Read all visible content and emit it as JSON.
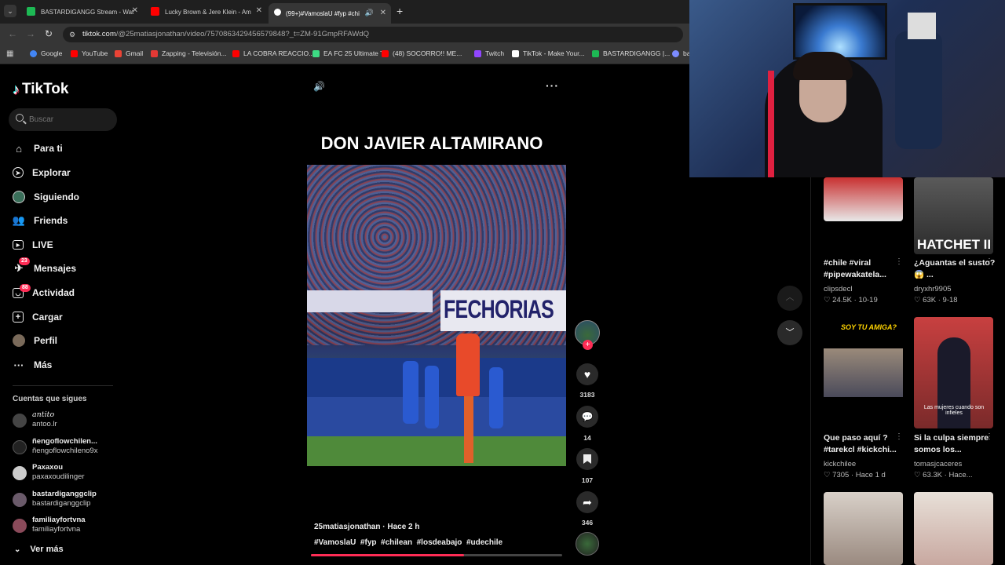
{
  "browser": {
    "tabs": [
      {
        "title": "BASTARDIGANGG Stream - Wat",
        "color": "#1db954"
      },
      {
        "title": "Lucky Brown & Jere Klein - Am",
        "color": "#ff0000"
      },
      {
        "title": "(99+)#VamoslaU #fyp #chi",
        "color": "#ffffff"
      }
    ],
    "url_host": "tiktok.com",
    "url_path": "/@25matiasjonathan/video/7570863429456579848?_t=ZM-91GmpRFAWdQ",
    "bookmarks": [
      {
        "label": "Google",
        "color": "#4285f4"
      },
      {
        "label": "YouTube",
        "color": "#ff0000"
      },
      {
        "label": "Gmail",
        "color": "#ea4335"
      },
      {
        "label": "Zapping - Televisión...",
        "color": "#e53935"
      },
      {
        "label": "LA COBRA REACCIO...",
        "color": "#ff0000"
      },
      {
        "label": "EA FC 25 Ultimate T...",
        "color": "#3ddc84"
      },
      {
        "label": "(48) SOCORRO!! ME...",
        "color": "#ff0000"
      },
      {
        "label": "Twitch",
        "color": "#9146ff"
      },
      {
        "label": "TikTok - Make Your...",
        "color": "#ffffff"
      },
      {
        "label": "BASTARDIGANGG |...",
        "color": "#1db954"
      },
      {
        "label": "ba",
        "color": "#7c8cff"
      }
    ]
  },
  "brand": {
    "name": "TikTok",
    "accent": "#fe2c55"
  },
  "search": {
    "placeholder": "Buscar"
  },
  "nav": [
    {
      "label": "Para ti",
      "icon": "home-icon",
      "badge": ""
    },
    {
      "label": "Explorar",
      "icon": "compass-icon",
      "badge": ""
    },
    {
      "label": "Siguiendo",
      "icon": "following-avatar-icon",
      "badge": ""
    },
    {
      "label": "Friends",
      "icon": "friends-icon",
      "badge": ""
    },
    {
      "label": "LIVE",
      "icon": "live-icon",
      "badge": ""
    },
    {
      "label": "Mensajes",
      "icon": "messages-icon",
      "badge": "23"
    },
    {
      "label": "Actividad",
      "icon": "activity-icon",
      "badge": "88"
    },
    {
      "label": "Cargar",
      "icon": "upload-icon",
      "badge": ""
    },
    {
      "label": "Perfil",
      "icon": "profile-avatar-icon",
      "badge": ""
    },
    {
      "label": "Más",
      "icon": "more-icon",
      "badge": ""
    }
  ],
  "following_title": "Cuentas que sigues",
  "following": [
    {
      "name": "antito",
      "handle": "antoo.lr"
    },
    {
      "name": "ñengoflowchilen...",
      "handle": "ñengoflowchileno9x"
    },
    {
      "name": "Paxaxou",
      "handle": "paxaxoudilinger"
    },
    {
      "name": "bastardiganggclip",
      "handle": "bastardiganggclip"
    },
    {
      "name": "familiayfortvna",
      "handle": "familiayfortvna"
    }
  ],
  "see_more": "Ver más",
  "video": {
    "title": "DON JAVIER ALTAMIRANO",
    "banner_text": "FECHORIAS",
    "author": "25matiasjonathan",
    "time": "Hace 2 h",
    "hashtags": "#VamoslaU  #fyp  #chilean  #losdeabajo  #udechile",
    "progress": 0.61,
    "likes": "3183",
    "comments": "14",
    "saves": "107",
    "shares": "346"
  },
  "related": [
    {
      "caption": "#chile #viral #pipewakatela...",
      "user": "clipsdecl",
      "likes": "24.5K",
      "date": "10-19"
    },
    {
      "caption": "¿Aguantas el susto? 😱 ...",
      "user": "dryxhr9905",
      "likes": "63K",
      "date": "9-18",
      "overlay": "HATCHET II"
    },
    {
      "caption": "Que paso aquí ? #tarekcl #kickchi...",
      "user": "kickchilee",
      "likes": "7305",
      "date": "Hace 1 d",
      "overlay": "SOY TU AMIGA?"
    },
    {
      "caption": "Si la culpa siempre somos los...",
      "user": "tomasjcaceres",
      "likes": "63.3K",
      "date": "Hace...",
      "overlay": "Las mujeres cuando son infieles"
    }
  ]
}
